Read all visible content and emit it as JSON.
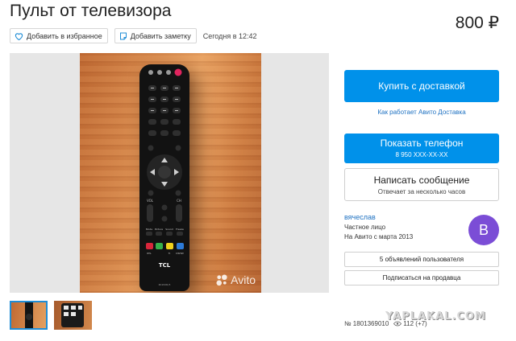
{
  "listing": {
    "title": "Пульт от телевизора",
    "price": "800 ₽",
    "favorite_label": "Добавить в избранное",
    "note_label": "Добавить заметку",
    "posted": "Сегодня в 12:42",
    "ad_number": "№ 1801369010",
    "views": "112 (+7)"
  },
  "gallery": {
    "photo_watermark": "Avito",
    "remote_brand": "TCL",
    "remote_model": "RC200R/3",
    "remote_labels": [
      "Mode",
      "Picture",
      "Sound",
      "Freeze"
    ],
    "remote_color_labels": [
      "RTL",
      "",
      "Ti",
      "DSHW"
    ],
    "vol_label": "VOL",
    "ch_label": "CH",
    "thumbnail_count": 2
  },
  "sidebar": {
    "buy_label": "Купить с доставкой",
    "delivery_link": "Как работает Авито Доставка",
    "phone_label": "Показать телефон",
    "phone_number": "8 950 XXX-XX-XX",
    "message_label": "Написать сообщение",
    "message_sub": "Отвечает за несколько часов",
    "seller_name": "вячеслав",
    "seller_type": "Частное лицо",
    "seller_since": "На Авито с марта 2013",
    "avatar_letter": "В",
    "ads_label": "5 объявлений пользователя",
    "subscribe_label": "Подписаться на продавца"
  },
  "overlay": {
    "site_watermark": "YAPLAKAL.COM"
  },
  "colors": {
    "accent": "#0091ea",
    "link": "#1f72c2",
    "avatar": "#7b4dd6",
    "wood": "#d88a4d"
  }
}
